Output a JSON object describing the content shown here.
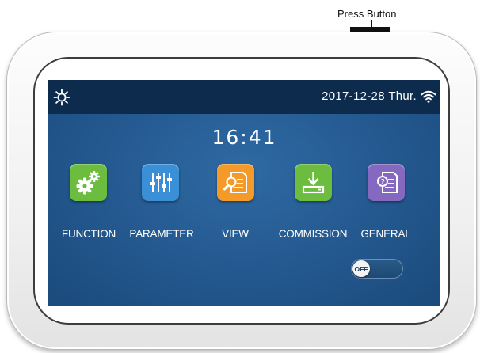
{
  "callout": {
    "label": "Press Button"
  },
  "status_bar": {
    "settings_icon": "gear-icon",
    "date": "2017-12-28",
    "weekday": "Thur.",
    "wifi_icon": "wifi-icon"
  },
  "clock": {
    "time": "16:41"
  },
  "tiles": [
    {
      "label": "FUNCTION",
      "icon": "gears-icon",
      "color": "#6cbc3f"
    },
    {
      "label": "PARAMETER",
      "icon": "sliders-icon",
      "color": "#3b8fd6"
    },
    {
      "label": "VIEW",
      "icon": "document-search-icon",
      "color": "#f39a28"
    },
    {
      "label": "COMMISSION",
      "icon": "download-icon",
      "color": "#6cbc3f"
    },
    {
      "label": "GENERAL",
      "icon": "document-question-icon",
      "color": "#8569c0"
    }
  ],
  "toggle": {
    "label": "OFF",
    "state": "off"
  }
}
